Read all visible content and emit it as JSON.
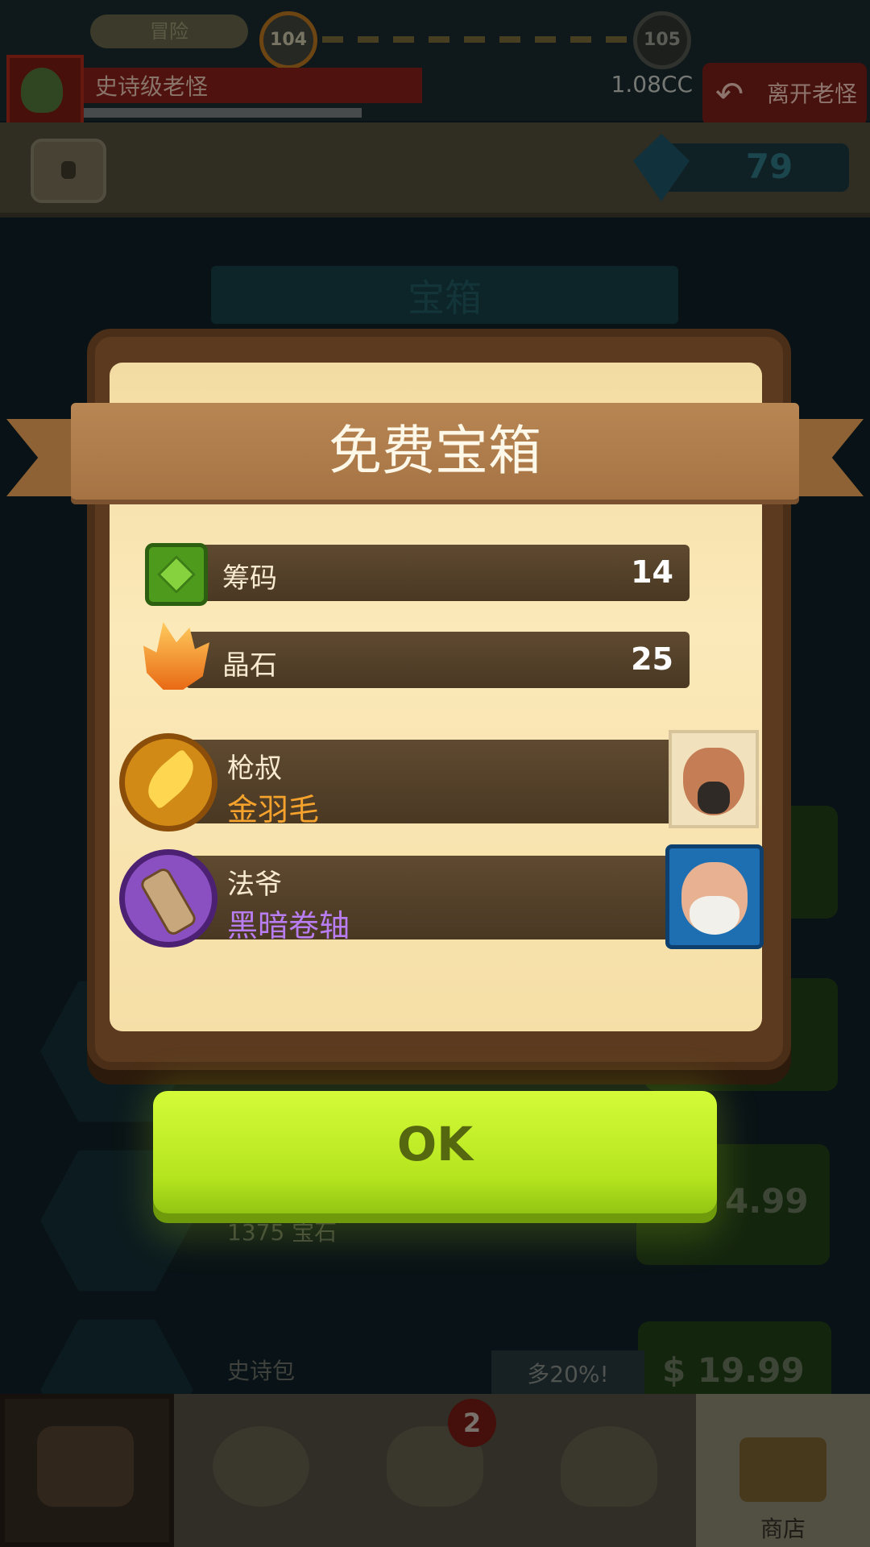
{
  "background": {
    "mode_label": "冒险",
    "level_current": "104",
    "level_next": "105",
    "boss_name": "史诗级老怪",
    "boss_hp": "1.08CC",
    "leave_label": "离开老怪",
    "gem_count": "79",
    "store_title": "宝箱",
    "ghost_price_1": "4.99",
    "ghost_text_1": "1375 宝石",
    "ghost_text_2": "史诗包",
    "ghost_bonus": "多20%!",
    "ghost_price_2": "$ 19.99"
  },
  "dialog": {
    "title": "免费宝箱",
    "rewards": [
      {
        "label": "筹码",
        "value": "14",
        "icon": "chip-icon"
      },
      {
        "label": "晶石",
        "value": "25",
        "icon": "crystal-icon"
      }
    ],
    "hero_rewards": [
      {
        "hero": "枪叔",
        "item": "金羽毛",
        "item_color": "#f6a32d",
        "icon": "feather-icon"
      },
      {
        "hero": "法爷",
        "item": "黑暗卷轴",
        "item_color": "#b97df2",
        "icon": "scroll-icon"
      }
    ],
    "ok_label": "OK"
  },
  "navbar": {
    "badge_count": "2",
    "shop_label": "商店"
  }
}
